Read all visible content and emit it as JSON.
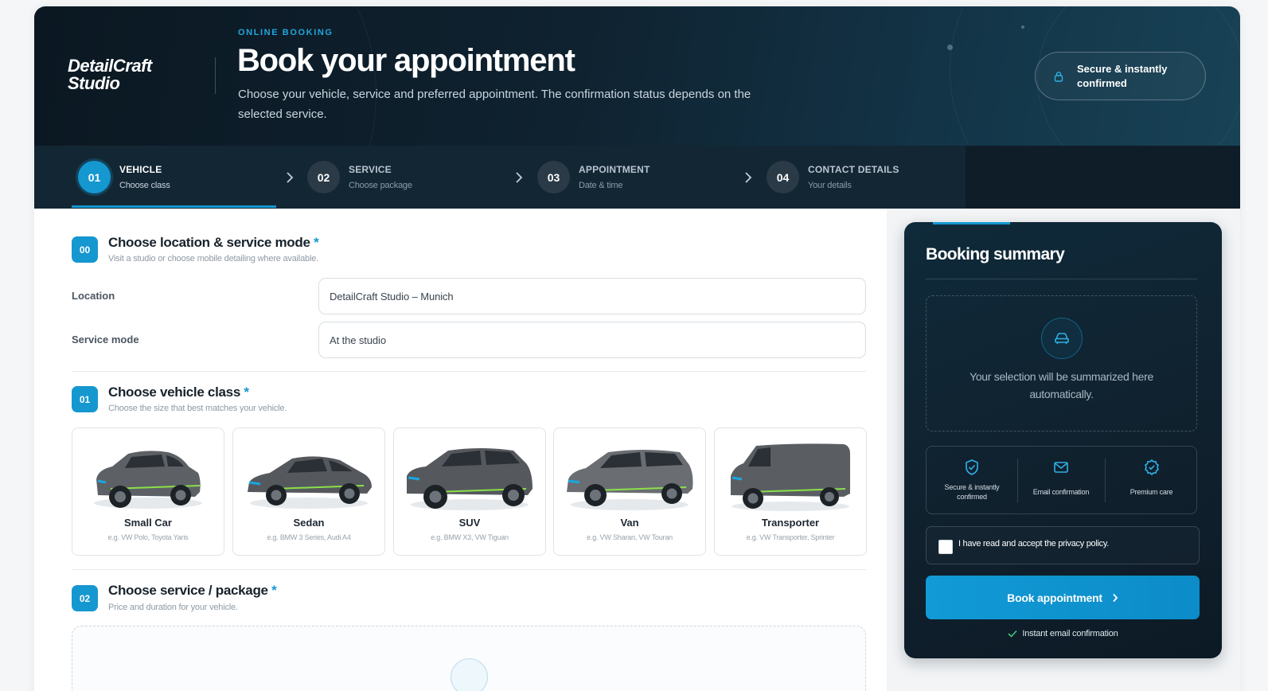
{
  "header": {
    "logo_line1": "DetailCraft",
    "logo_line2": "Studio",
    "eyebrow": "ONLINE BOOKING",
    "title": "Book your appointment",
    "subtitle": "Choose your vehicle, service and preferred appointment. The confirmation status depends on the selected service.",
    "secure_badge": "Secure & instantly confirmed"
  },
  "steps": [
    {
      "num": "01",
      "label": "VEHICLE",
      "sub": "Choose class",
      "active": true
    },
    {
      "num": "02",
      "label": "SERVICE",
      "sub": "Choose package",
      "active": false
    },
    {
      "num": "03",
      "label": "APPOINTMENT",
      "sub": "Date & time",
      "active": false
    },
    {
      "num": "04",
      "label": "CONTACT DETAILS",
      "sub": "Your details",
      "active": false
    }
  ],
  "location_section": {
    "num": "00",
    "title": "Choose location & service mode",
    "required_mark": "*",
    "subtitle": "Visit a studio or choose mobile detailing where available.",
    "location_label": "Location",
    "location_value": "DetailCraft Studio – Munich",
    "mode_label": "Service mode",
    "mode_value": "At the studio"
  },
  "vehicle_section": {
    "num": "01",
    "title": "Choose vehicle class",
    "required_mark": "*",
    "subtitle": "Choose the size that best matches your vehicle.",
    "vehicles": [
      {
        "name": "Small Car",
        "example": "e.g. VW Polo, Toyota Yaris",
        "icon": "small-car-icon"
      },
      {
        "name": "Sedan",
        "example": "e.g. BMW 3 Series, Audi A4",
        "icon": "sedan-icon"
      },
      {
        "name": "SUV",
        "example": "e.g. BMW X3, VW Tiguan",
        "icon": "suv-icon"
      },
      {
        "name": "Van",
        "example": "e.g. VW Sharan, VW Touran",
        "icon": "van-icon"
      },
      {
        "name": "Transporter",
        "example": "e.g. VW Transporter, Sprinter",
        "icon": "transporter-icon"
      }
    ]
  },
  "package_section": {
    "num": "02",
    "title": "Choose service / package",
    "required_mark": "*",
    "subtitle": "Price and duration for your vehicle."
  },
  "summary": {
    "title": "Booking summary",
    "empty_text": "Your selection will be summarized here automatically.",
    "features": [
      {
        "label": "Secure & instantly confirmed",
        "icon": "shield-check-icon"
      },
      {
        "label": "Email confirmation",
        "icon": "envelope-icon"
      },
      {
        "label": "Premium care",
        "icon": "badge-check-icon"
      }
    ],
    "privacy_label": "I have read and accept the privacy policy.",
    "privacy_checked": false,
    "book_button": "Book appointment",
    "instant_note": "Instant email confirmation"
  },
  "colors": {
    "accent": "#1597d0",
    "header_dark": "#0f2230",
    "summary_dark": "#10212e"
  }
}
